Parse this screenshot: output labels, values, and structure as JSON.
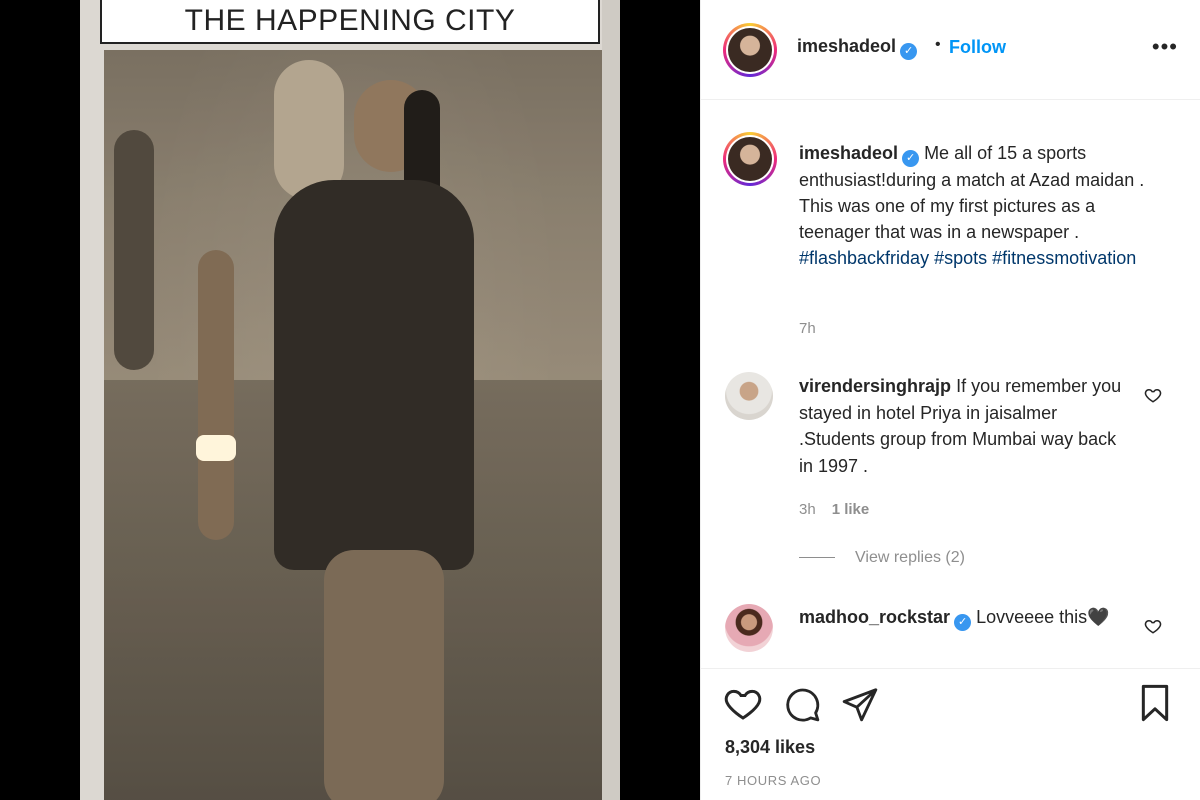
{
  "clipping": {
    "header": "THE HAPPENING CITY"
  },
  "post": {
    "username": "imeshadeol",
    "follow_label": "Follow",
    "follow_dot": "•",
    "more_label": "•••",
    "caption": {
      "text": "Me all of 15 a sports enthusiast!during a match at Azad maidan . This was one of my first pictures as a teenager that was in a newspaper . ",
      "hashtags": [
        "#flashbackfriday",
        "#spots",
        "#fitnessmotivation"
      ],
      "time": "7h"
    },
    "comments": [
      {
        "username": "virendersinghrajp",
        "text": "If you remember you stayed in hotel Priya in jaisalmer .Students group from Mumbai way back in 1997 .",
        "time": "3h",
        "likes": "1 like",
        "replies": "View replies (2)"
      },
      {
        "username": "madhoo_rockstar",
        "text": "Lovveeee this🖤",
        "verified": true
      }
    ],
    "likes_count": "8,304 likes",
    "posted": "7 HOURS AGO"
  },
  "colors": {
    "link_blue": "#0095f6",
    "hashtag": "#00376b",
    "verified": "#3897f0",
    "muted": "#8e8e8e"
  },
  "icons": {
    "like": "heart-icon",
    "comment": "comment-icon",
    "share": "share-icon",
    "save": "bookmark-icon",
    "more": "more-icon"
  }
}
